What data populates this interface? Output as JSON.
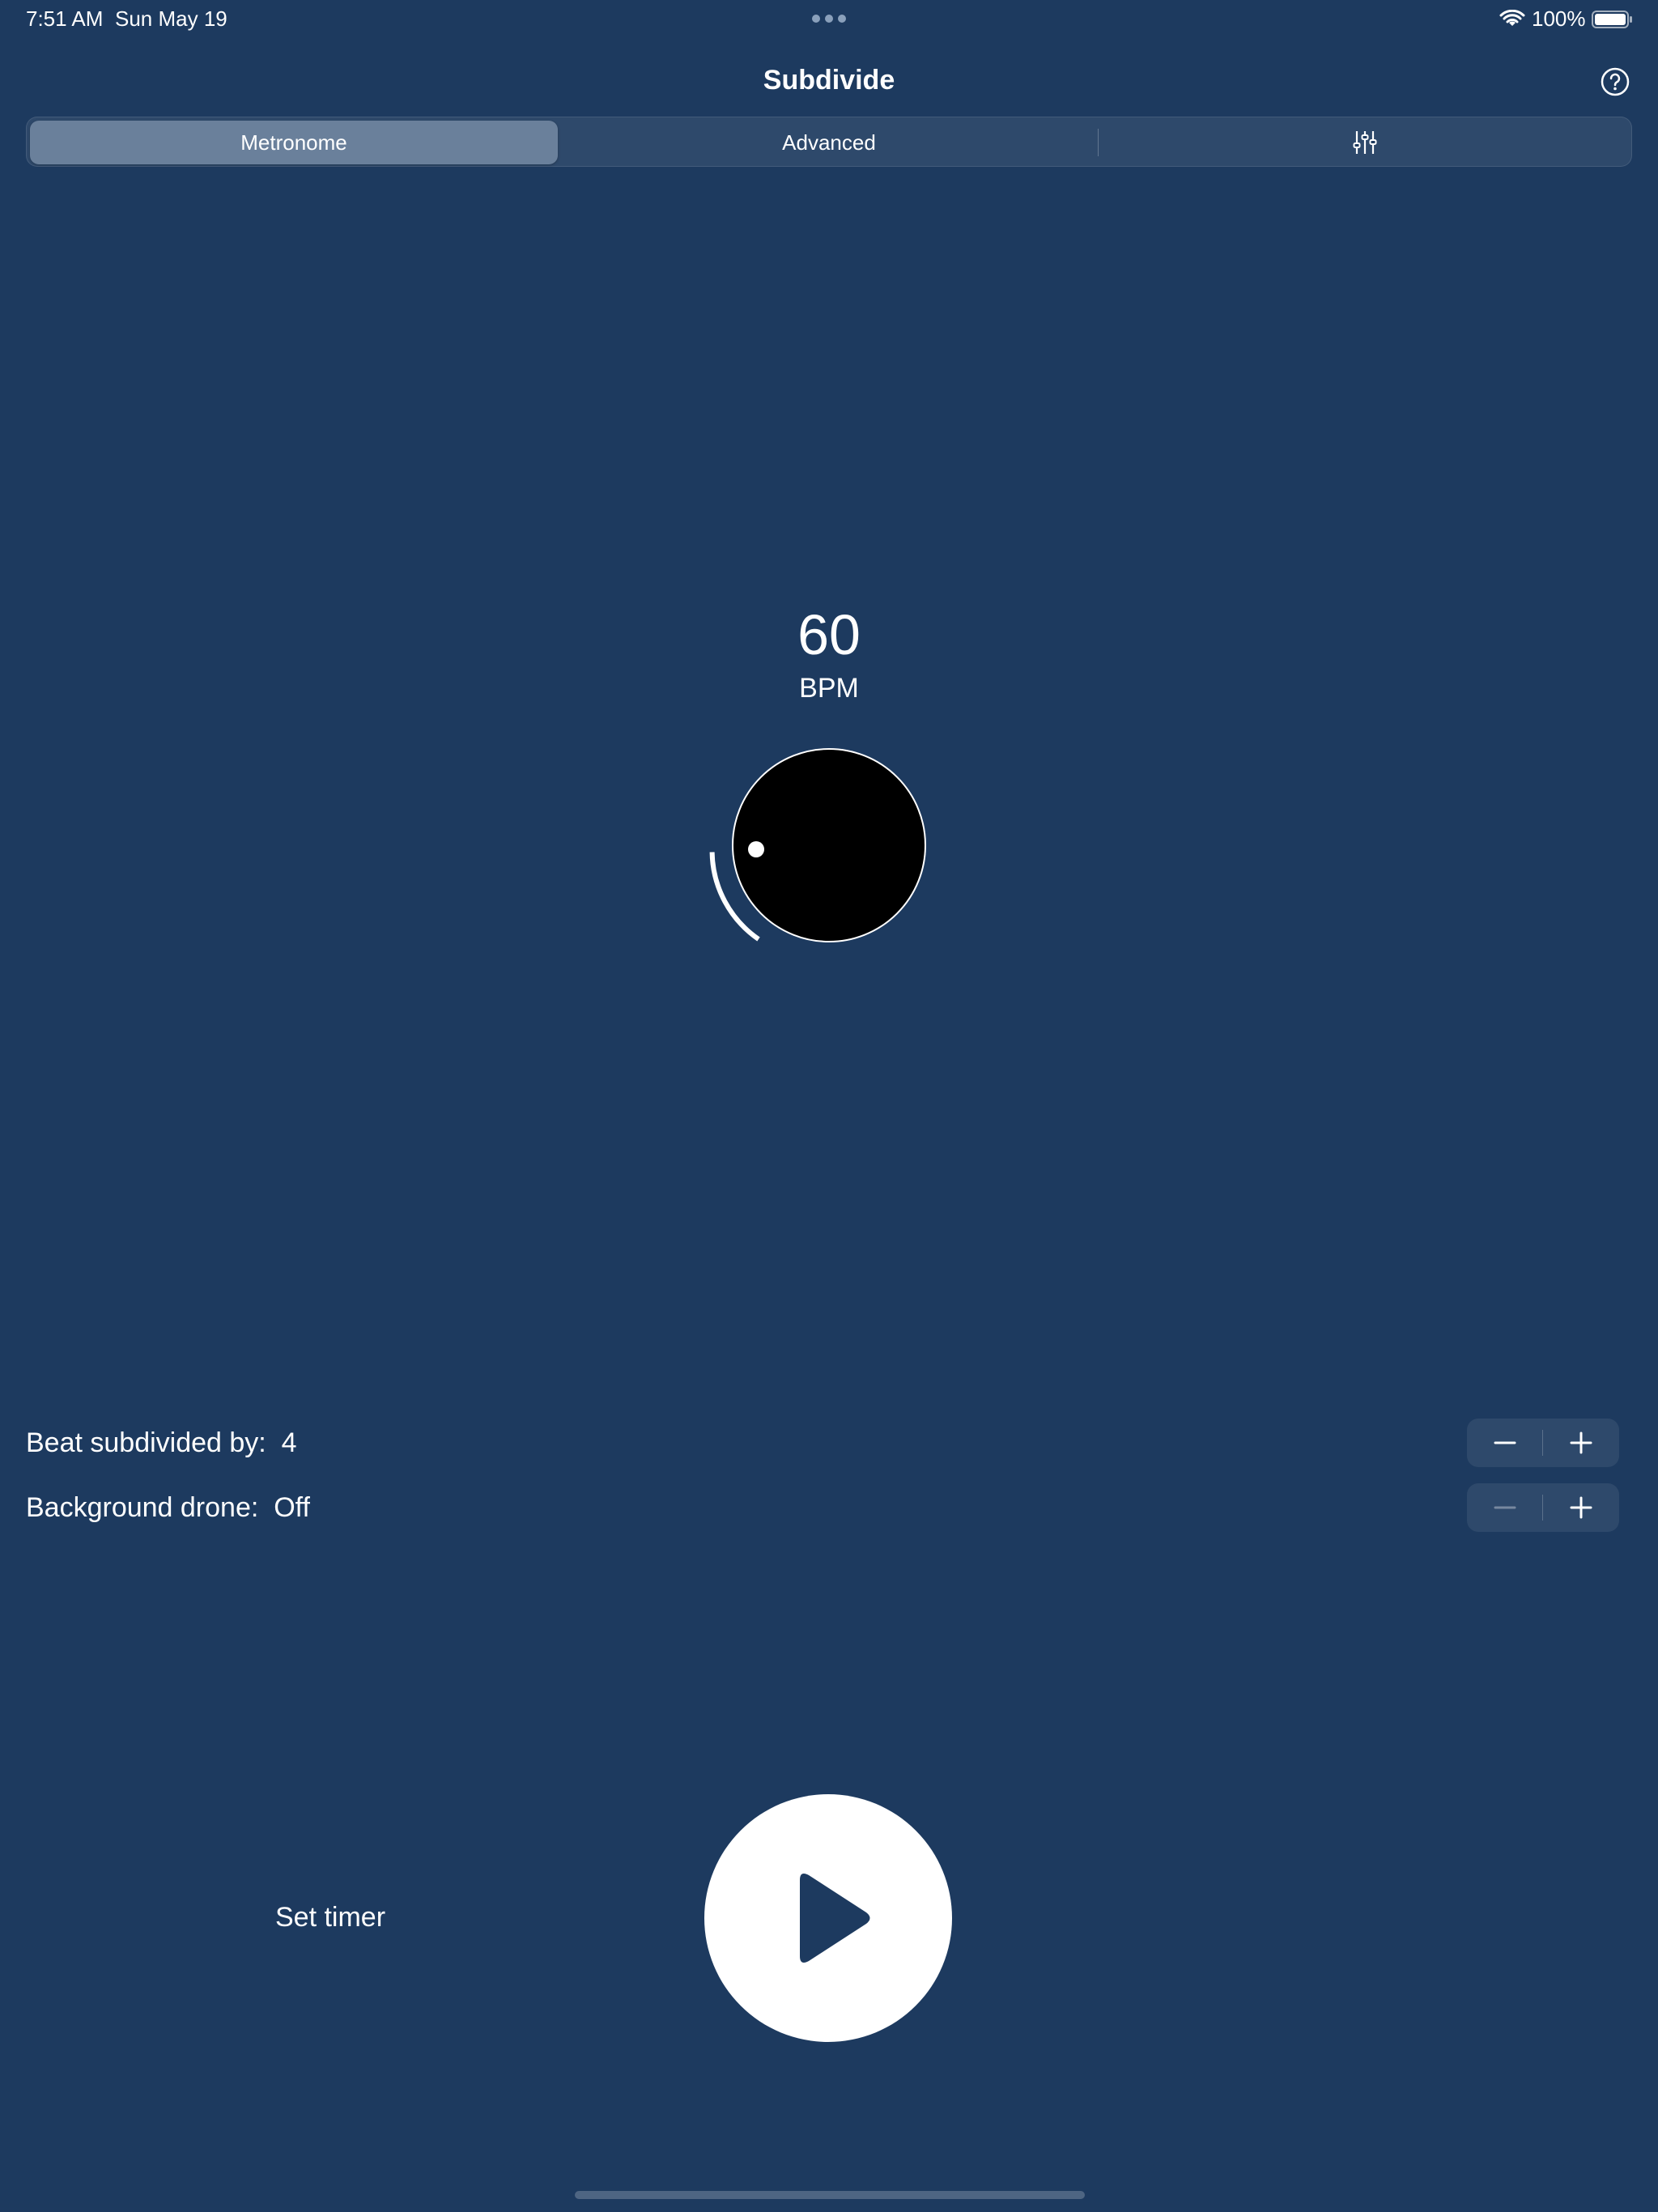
{
  "status_bar": {
    "time": "7:51 AM",
    "date": "Sun May 19",
    "battery_percent": "100%",
    "icons": [
      "wifi-icon",
      "battery-icon",
      "more-dots-icon"
    ]
  },
  "header": {
    "title": "Subdivide",
    "help_icon": "question-circle-icon"
  },
  "tabs": {
    "items": [
      {
        "label": "Metronome",
        "selected": true
      },
      {
        "label": "Advanced",
        "selected": false
      },
      {
        "label": "",
        "icon": "sliders-icon",
        "selected": false
      }
    ]
  },
  "tempo": {
    "bpm": "60",
    "unit": "BPM",
    "dial_icon": "tempo-knob-icon"
  },
  "settings": {
    "subdivision": {
      "label": "Beat subdivided by:",
      "value": "4"
    },
    "drone": {
      "label": "Background drone:",
      "value": "Off"
    }
  },
  "controls": {
    "set_timer_label": "Set timer",
    "play_icon": "play-icon"
  },
  "colors": {
    "background": "#1d3a5f",
    "foreground": "#ffffff",
    "knob": "#000000"
  }
}
